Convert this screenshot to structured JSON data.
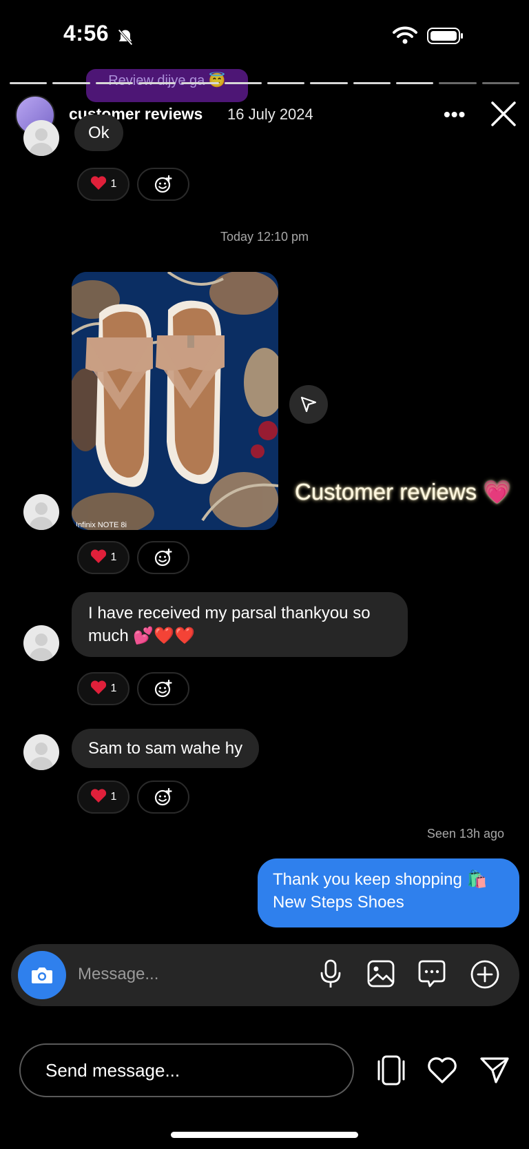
{
  "status_bar": {
    "time": "4:56"
  },
  "peek_message": {
    "text": "Review dijye ga 😇"
  },
  "story": {
    "username": "customer reviews",
    "date": "16 July 2024"
  },
  "messages": [
    {
      "text": "Ok",
      "reaction_count": "1"
    },
    {
      "timestamp": "Today 12:10 pm"
    },
    {
      "photo_watermark": "Infinix NOTE 8i",
      "reaction_count": "1"
    },
    {
      "text": "I have received my parsal thankyou so much 💕❤️❤️",
      "reaction_count": "1"
    },
    {
      "text": "Sam to sam wahe hy",
      "reaction_count": "1"
    }
  ],
  "sticker": {
    "text": "Customer reviews 💗"
  },
  "seen": "Seen 13h ago",
  "sent": {
    "text": "Thank you keep shopping 🛍️ New Steps Shoes"
  },
  "composer": {
    "placeholder": "Message..."
  },
  "story_reply": {
    "placeholder": "Send message..."
  },
  "icons": [
    "bell-slash-icon",
    "wifi-icon",
    "battery-icon",
    "more-icon",
    "close-icon",
    "heart-icon",
    "add-reaction-icon",
    "share-icon",
    "camera-icon",
    "mic-icon",
    "gallery-icon",
    "sticker-icon",
    "plus-icon",
    "story-frame-icon",
    "like-icon",
    "send-icon"
  ],
  "colors": {
    "accent": "#2f80ed",
    "bubble": "#262626",
    "heart": "#e0203a"
  }
}
